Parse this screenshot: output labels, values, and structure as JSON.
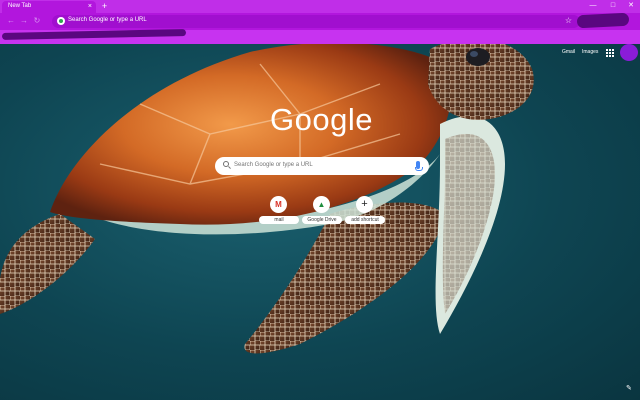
{
  "browser": {
    "tab_title": "New Tab",
    "tab_close": "×",
    "new_tab": "+",
    "window_controls": [
      "—",
      "□",
      "✕"
    ],
    "nav_icons": [
      "back-icon",
      "forward-icon",
      "reload-icon"
    ],
    "nav_glyphs": [
      "←",
      "→",
      "↻"
    ],
    "omnibox_text": "Search Google or type a URL",
    "bookmark_star": "☆"
  },
  "header": {
    "gmail_label": "Gmail",
    "images_label": "Images"
  },
  "logo": "Google",
  "search": {
    "placeholder": "Search Google or type a URL"
  },
  "shortcuts": [
    {
      "label": "mail",
      "glyph": "M",
      "icon": "gmail-icon"
    },
    {
      "label": "Google Drive",
      "glyph": "▲",
      "icon": "google-drive-icon"
    },
    {
      "label": "add shortcut",
      "glyph": "+",
      "icon": "add-icon"
    }
  ],
  "customize_glyph": "✎",
  "colors": {
    "frame": "#c733f0",
    "toolbar": "#b216dd",
    "omnibox": "#a10fcf",
    "scribble": "#5a0780"
  }
}
